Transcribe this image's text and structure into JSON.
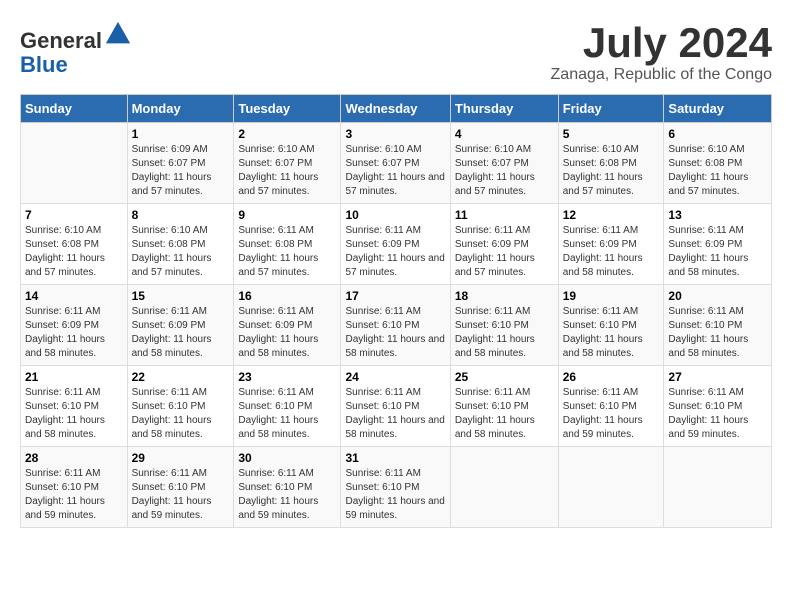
{
  "header": {
    "logo_line1": "General",
    "logo_line2": "Blue",
    "title": "July 2024",
    "subtitle": "Zanaga, Republic of the Congo"
  },
  "weekdays": [
    "Sunday",
    "Monday",
    "Tuesday",
    "Wednesday",
    "Thursday",
    "Friday",
    "Saturday"
  ],
  "weeks": [
    [
      {
        "day": "",
        "sunrise": "",
        "sunset": "",
        "daylight": ""
      },
      {
        "day": "1",
        "sunrise": "Sunrise: 6:09 AM",
        "sunset": "Sunset: 6:07 PM",
        "daylight": "Daylight: 11 hours and 57 minutes."
      },
      {
        "day": "2",
        "sunrise": "Sunrise: 6:10 AM",
        "sunset": "Sunset: 6:07 PM",
        "daylight": "Daylight: 11 hours and 57 minutes."
      },
      {
        "day": "3",
        "sunrise": "Sunrise: 6:10 AM",
        "sunset": "Sunset: 6:07 PM",
        "daylight": "Daylight: 11 hours and 57 minutes."
      },
      {
        "day": "4",
        "sunrise": "Sunrise: 6:10 AM",
        "sunset": "Sunset: 6:07 PM",
        "daylight": "Daylight: 11 hours and 57 minutes."
      },
      {
        "day": "5",
        "sunrise": "Sunrise: 6:10 AM",
        "sunset": "Sunset: 6:08 PM",
        "daylight": "Daylight: 11 hours and 57 minutes."
      },
      {
        "day": "6",
        "sunrise": "Sunrise: 6:10 AM",
        "sunset": "Sunset: 6:08 PM",
        "daylight": "Daylight: 11 hours and 57 minutes."
      }
    ],
    [
      {
        "day": "7",
        "sunrise": "Sunrise: 6:10 AM",
        "sunset": "Sunset: 6:08 PM",
        "daylight": "Daylight: 11 hours and 57 minutes."
      },
      {
        "day": "8",
        "sunrise": "Sunrise: 6:10 AM",
        "sunset": "Sunset: 6:08 PM",
        "daylight": "Daylight: 11 hours and 57 minutes."
      },
      {
        "day": "9",
        "sunrise": "Sunrise: 6:11 AM",
        "sunset": "Sunset: 6:08 PM",
        "daylight": "Daylight: 11 hours and 57 minutes."
      },
      {
        "day": "10",
        "sunrise": "Sunrise: 6:11 AM",
        "sunset": "Sunset: 6:09 PM",
        "daylight": "Daylight: 11 hours and 57 minutes."
      },
      {
        "day": "11",
        "sunrise": "Sunrise: 6:11 AM",
        "sunset": "Sunset: 6:09 PM",
        "daylight": "Daylight: 11 hours and 57 minutes."
      },
      {
        "day": "12",
        "sunrise": "Sunrise: 6:11 AM",
        "sunset": "Sunset: 6:09 PM",
        "daylight": "Daylight: 11 hours and 58 minutes."
      },
      {
        "day": "13",
        "sunrise": "Sunrise: 6:11 AM",
        "sunset": "Sunset: 6:09 PM",
        "daylight": "Daylight: 11 hours and 58 minutes."
      }
    ],
    [
      {
        "day": "14",
        "sunrise": "Sunrise: 6:11 AM",
        "sunset": "Sunset: 6:09 PM",
        "daylight": "Daylight: 11 hours and 58 minutes."
      },
      {
        "day": "15",
        "sunrise": "Sunrise: 6:11 AM",
        "sunset": "Sunset: 6:09 PM",
        "daylight": "Daylight: 11 hours and 58 minutes."
      },
      {
        "day": "16",
        "sunrise": "Sunrise: 6:11 AM",
        "sunset": "Sunset: 6:09 PM",
        "daylight": "Daylight: 11 hours and 58 minutes."
      },
      {
        "day": "17",
        "sunrise": "Sunrise: 6:11 AM",
        "sunset": "Sunset: 6:10 PM",
        "daylight": "Daylight: 11 hours and 58 minutes."
      },
      {
        "day": "18",
        "sunrise": "Sunrise: 6:11 AM",
        "sunset": "Sunset: 6:10 PM",
        "daylight": "Daylight: 11 hours and 58 minutes."
      },
      {
        "day": "19",
        "sunrise": "Sunrise: 6:11 AM",
        "sunset": "Sunset: 6:10 PM",
        "daylight": "Daylight: 11 hours and 58 minutes."
      },
      {
        "day": "20",
        "sunrise": "Sunrise: 6:11 AM",
        "sunset": "Sunset: 6:10 PM",
        "daylight": "Daylight: 11 hours and 58 minutes."
      }
    ],
    [
      {
        "day": "21",
        "sunrise": "Sunrise: 6:11 AM",
        "sunset": "Sunset: 6:10 PM",
        "daylight": "Daylight: 11 hours and 58 minutes."
      },
      {
        "day": "22",
        "sunrise": "Sunrise: 6:11 AM",
        "sunset": "Sunset: 6:10 PM",
        "daylight": "Daylight: 11 hours and 58 minutes."
      },
      {
        "day": "23",
        "sunrise": "Sunrise: 6:11 AM",
        "sunset": "Sunset: 6:10 PM",
        "daylight": "Daylight: 11 hours and 58 minutes."
      },
      {
        "day": "24",
        "sunrise": "Sunrise: 6:11 AM",
        "sunset": "Sunset: 6:10 PM",
        "daylight": "Daylight: 11 hours and 58 minutes."
      },
      {
        "day": "25",
        "sunrise": "Sunrise: 6:11 AM",
        "sunset": "Sunset: 6:10 PM",
        "daylight": "Daylight: 11 hours and 58 minutes."
      },
      {
        "day": "26",
        "sunrise": "Sunrise: 6:11 AM",
        "sunset": "Sunset: 6:10 PM",
        "daylight": "Daylight: 11 hours and 59 minutes."
      },
      {
        "day": "27",
        "sunrise": "Sunrise: 6:11 AM",
        "sunset": "Sunset: 6:10 PM",
        "daylight": "Daylight: 11 hours and 59 minutes."
      }
    ],
    [
      {
        "day": "28",
        "sunrise": "Sunrise: 6:11 AM",
        "sunset": "Sunset: 6:10 PM",
        "daylight": "Daylight: 11 hours and 59 minutes."
      },
      {
        "day": "29",
        "sunrise": "Sunrise: 6:11 AM",
        "sunset": "Sunset: 6:10 PM",
        "daylight": "Daylight: 11 hours and 59 minutes."
      },
      {
        "day": "30",
        "sunrise": "Sunrise: 6:11 AM",
        "sunset": "Sunset: 6:10 PM",
        "daylight": "Daylight: 11 hours and 59 minutes."
      },
      {
        "day": "31",
        "sunrise": "Sunrise: 6:11 AM",
        "sunset": "Sunset: 6:10 PM",
        "daylight": "Daylight: 11 hours and 59 minutes."
      },
      {
        "day": "",
        "sunrise": "",
        "sunset": "",
        "daylight": ""
      },
      {
        "day": "",
        "sunrise": "",
        "sunset": "",
        "daylight": ""
      },
      {
        "day": "",
        "sunrise": "",
        "sunset": "",
        "daylight": ""
      }
    ]
  ]
}
